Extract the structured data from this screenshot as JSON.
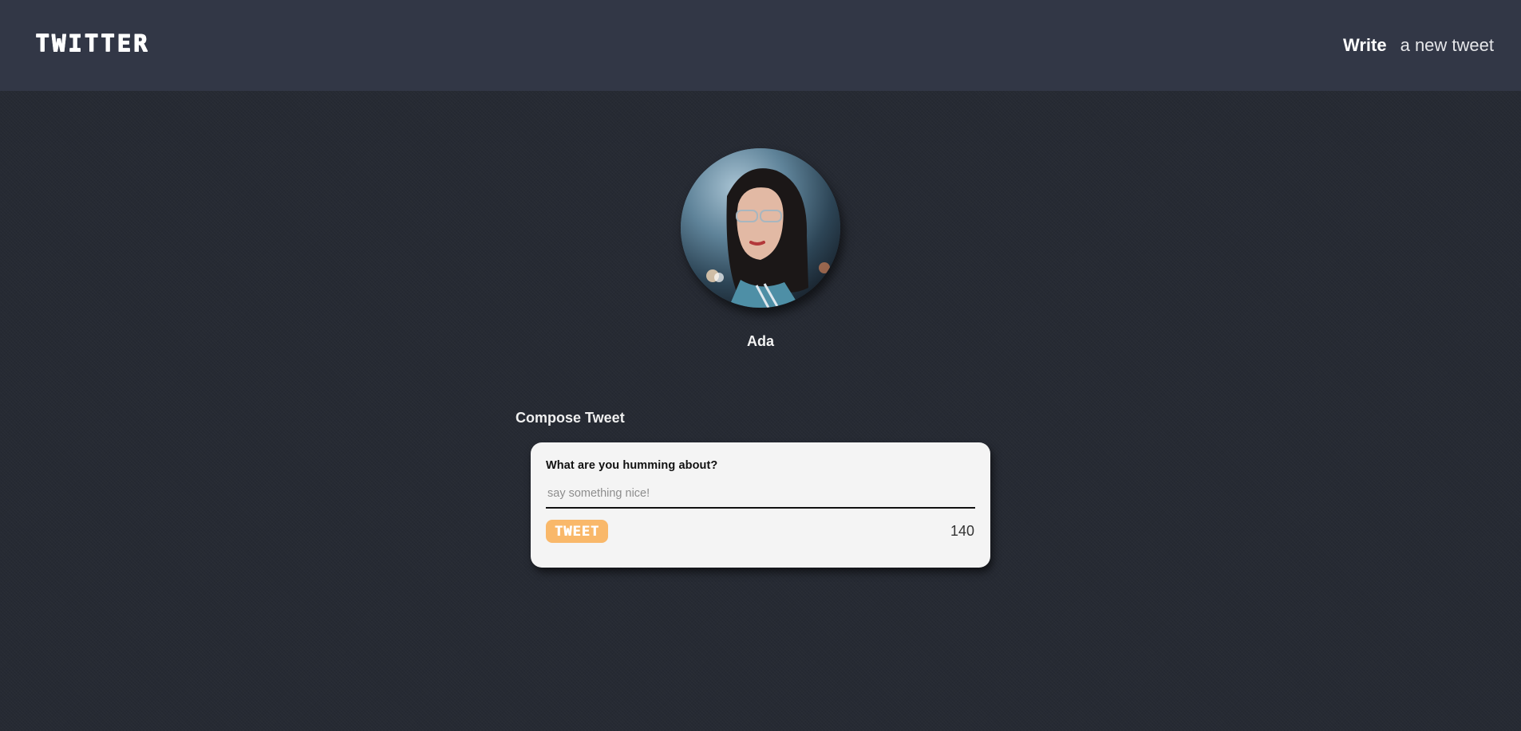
{
  "header": {
    "logo": "TWITTER",
    "nav_write_strong": "Write",
    "nav_write_light": "a new tweet"
  },
  "profile": {
    "name": "Ada"
  },
  "compose": {
    "section_title": "Compose Tweet",
    "question_label": "What are you humming about?",
    "input_placeholder": "say something nice!",
    "input_value": "",
    "submit_label": "TWEET",
    "char_counter": "140"
  },
  "colors": {
    "page_background": "#262a33",
    "header_background": "#323746",
    "card_background": "#f4f4f4",
    "tweet_button": "#f9b86a"
  }
}
